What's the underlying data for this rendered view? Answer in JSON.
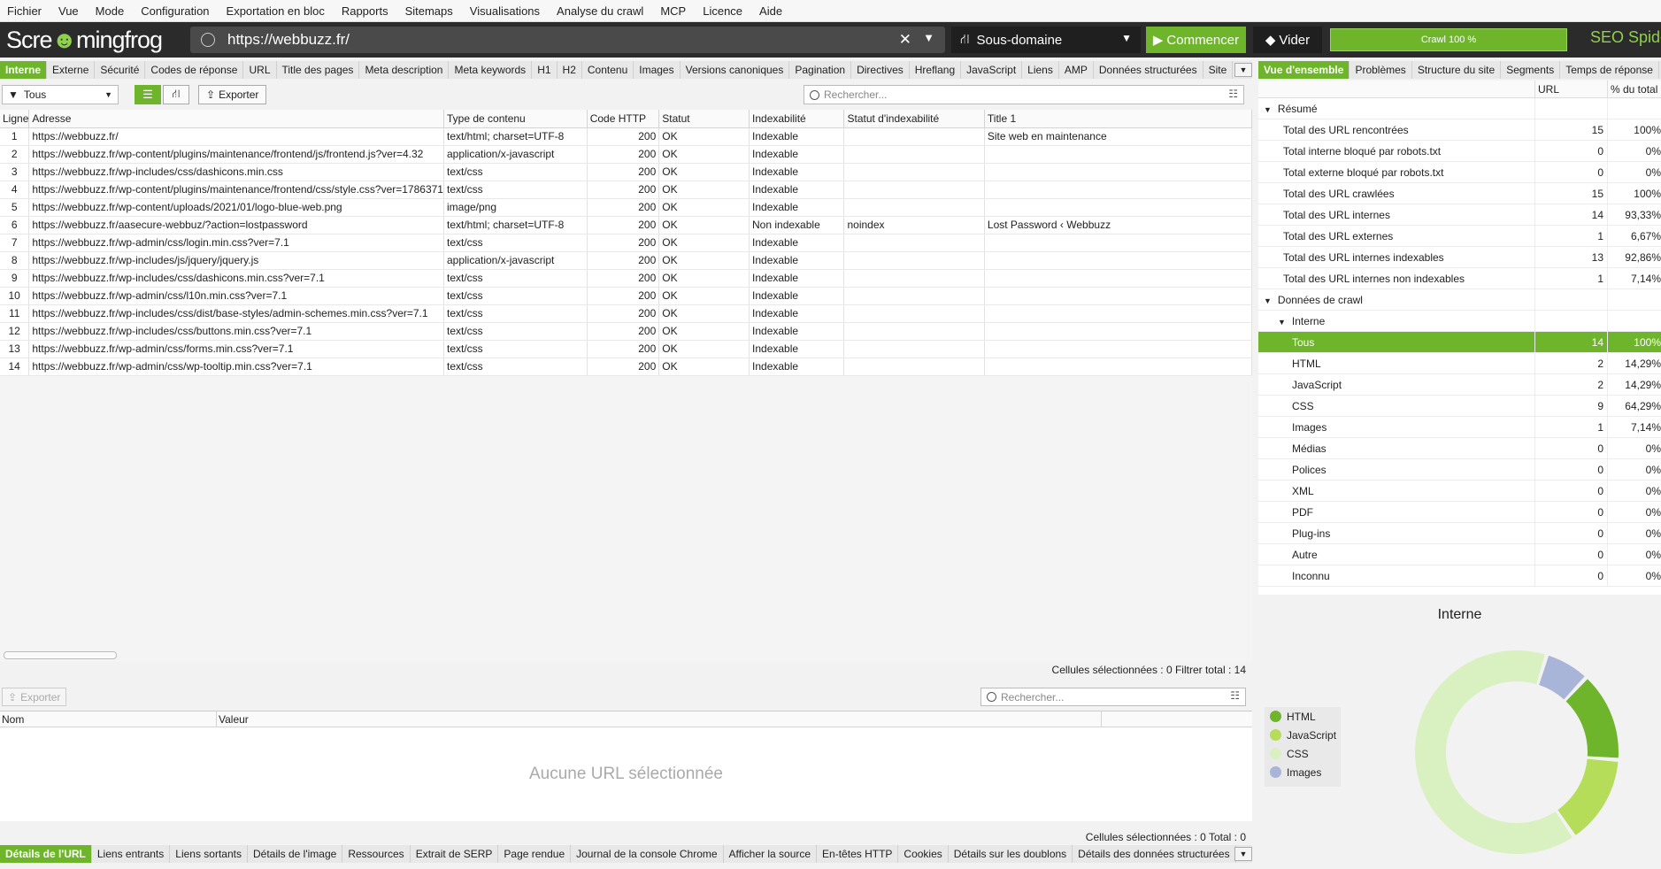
{
  "menu": [
    "Fichier",
    "Vue",
    "Mode",
    "Configuration",
    "Exportation en bloc",
    "Rapports",
    "Sitemaps",
    "Visualisations",
    "Analyse du crawl",
    "MCP",
    "Licence",
    "Aide"
  ],
  "logo": {
    "part1": "Scre",
    "part2": "mingfrog"
  },
  "url_value": "https://webbuzz.fr/",
  "mode_label": "Sous-domaine",
  "start_label": "Commencer",
  "clear_label": "Vider",
  "progress_label": "Crawl 100 %",
  "progress_value": 1.0,
  "product_label": "SEO Spider",
  "tabs": [
    "Interne",
    "Externe",
    "Sécurité",
    "Codes de réponse",
    "URL",
    "Title des pages",
    "Meta description",
    "Meta keywords",
    "H1",
    "H2",
    "Contenu",
    "Images",
    "Versions canoniques",
    "Pagination",
    "Directives",
    "Hreflang",
    "JavaScript",
    "Liens",
    "AMP",
    "Données structurées",
    "Site"
  ],
  "right_tabs": [
    "Vue d'ensemble",
    "Problèmes",
    "Structure du site",
    "Segments",
    "Temps de réponse"
  ],
  "filter_label": "Tous",
  "export_label": "Exporter",
  "search_placeholder": "Rechercher...",
  "table": {
    "columns": [
      "Ligne",
      "Adresse",
      "Type de contenu",
      "Code HTTP",
      "Statut",
      "Indexabilité",
      "Statut d'indexabilité",
      "Title 1"
    ],
    "rows": [
      [
        "1",
        "https://webbuzz.fr/",
        "text/html; charset=UTF-8",
        "200",
        "OK",
        "Indexable",
        "",
        "Site web en maintenance"
      ],
      [
        "2",
        "https://webbuzz.fr/wp-content/plugins/maintenance/frontend/js/frontend.js?ver=4.32",
        "application/x-javascript",
        "200",
        "OK",
        "Indexable",
        "",
        ""
      ],
      [
        "3",
        "https://webbuzz.fr/wp-includes/css/dashicons.min.css",
        "text/css",
        "200",
        "OK",
        "Indexable",
        "",
        ""
      ],
      [
        "4",
        "https://webbuzz.fr/wp-content/plugins/maintenance/frontend/css/style.css?ver=1786371",
        "text/css",
        "200",
        "OK",
        "Indexable",
        "",
        ""
      ],
      [
        "5",
        "https://webbuzz.fr/wp-content/uploads/2021/01/logo-blue-web.png",
        "image/png",
        "200",
        "OK",
        "Indexable",
        "",
        ""
      ],
      [
        "6",
        "https://webbuzz.fr/aasecure-webbuz/?action=lostpassword",
        "text/html; charset=UTF-8",
        "200",
        "OK",
        "Non indexable",
        "noindex",
        "Lost Password ‹ Webbuzz"
      ],
      [
        "7",
        "https://webbuzz.fr/wp-admin/css/login.min.css?ver=7.1",
        "text/css",
        "200",
        "OK",
        "Indexable",
        "",
        ""
      ],
      [
        "8",
        "https://webbuzz.fr/wp-includes/js/jquery/jquery.js",
        "application/x-javascript",
        "200",
        "OK",
        "Indexable",
        "",
        ""
      ],
      [
        "9",
        "https://webbuzz.fr/wp-includes/css/dashicons.min.css?ver=7.1",
        "text/css",
        "200",
        "OK",
        "Indexable",
        "",
        ""
      ],
      [
        "10",
        "https://webbuzz.fr/wp-admin/css/l10n.min.css?ver=7.1",
        "text/css",
        "200",
        "OK",
        "Indexable",
        "",
        ""
      ],
      [
        "11",
        "https://webbuzz.fr/wp-includes/css/dist/base-styles/admin-schemes.min.css?ver=7.1",
        "text/css",
        "200",
        "OK",
        "Indexable",
        "",
        ""
      ],
      [
        "12",
        "https://webbuzz.fr/wp-includes/css/buttons.min.css?ver=7.1",
        "text/css",
        "200",
        "OK",
        "Indexable",
        "",
        ""
      ],
      [
        "13",
        "https://webbuzz.fr/wp-admin/css/forms.min.css?ver=7.1",
        "text/css",
        "200",
        "OK",
        "Indexable",
        "",
        ""
      ],
      [
        "14",
        "https://webbuzz.fr/wp-admin/css/wp-tooltip.min.css?ver=7.1",
        "text/css",
        "200",
        "OK",
        "Indexable",
        "",
        ""
      ]
    ]
  },
  "status_top": "Cellules sélectionnées : 0  Filtrer total : 14",
  "lower": {
    "export_label": "Exporter",
    "search_placeholder": "Rechercher...",
    "col_name": "Nom",
    "col_value": "Valeur",
    "empty_message": "Aucune URL sélectionnée"
  },
  "status_bottom": "Cellules sélectionnées : 0  Total : 0",
  "bottom_tabs": [
    "Détails de l'URL",
    "Liens entrants",
    "Liens sortants",
    "Détails de l'image",
    "Ressources",
    "Extrait de SERP",
    "Page rendue",
    "Journal de la console Chrome",
    "Afficher la source",
    "En-têtes HTTP",
    "Cookies",
    "Détails sur les doublons",
    "Détails des données structurées"
  ],
  "overview": {
    "col_url": "URL",
    "col_pct": "% du total",
    "rows": [
      {
        "label": "Résumé",
        "url": "",
        "pct": "",
        "level": 0,
        "section": true
      },
      {
        "label": "Total des URL rencontrées",
        "url": "15",
        "pct": "100%",
        "level": 1
      },
      {
        "label": "Total interne bloqué par robots.txt",
        "url": "0",
        "pct": "0%",
        "level": 1
      },
      {
        "label": "Total externe bloqué par robots.txt",
        "url": "0",
        "pct": "0%",
        "level": 1
      },
      {
        "label": "Total des URL crawlées",
        "url": "15",
        "pct": "100%",
        "level": 1
      },
      {
        "label": "Total des URL internes",
        "url": "14",
        "pct": "93,33%",
        "level": 1
      },
      {
        "label": "Total des URL externes",
        "url": "1",
        "pct": "6,67%",
        "level": 1
      },
      {
        "label": "Total des URL internes indexables",
        "url": "13",
        "pct": "92,86%",
        "level": 1
      },
      {
        "label": "Total des URL internes non indexables",
        "url": "1",
        "pct": "7,14%",
        "level": 1
      },
      {
        "label": "Données de crawl",
        "url": "",
        "pct": "",
        "level": 0,
        "section": true
      },
      {
        "label": "Interne",
        "url": "",
        "pct": "",
        "level": 1,
        "section": true
      },
      {
        "label": "Tous",
        "url": "14",
        "pct": "100%",
        "level": 2,
        "selected": true
      },
      {
        "label": "HTML",
        "url": "2",
        "pct": "14,29%",
        "level": 2
      },
      {
        "label": "JavaScript",
        "url": "2",
        "pct": "14,29%",
        "level": 2
      },
      {
        "label": "CSS",
        "url": "9",
        "pct": "64,29%",
        "level": 2
      },
      {
        "label": "Images",
        "url": "1",
        "pct": "7,14%",
        "level": 2
      },
      {
        "label": "Médias",
        "url": "0",
        "pct": "0%",
        "level": 2
      },
      {
        "label": "Polices",
        "url": "0",
        "pct": "0%",
        "level": 2
      },
      {
        "label": "XML",
        "url": "0",
        "pct": "0%",
        "level": 2
      },
      {
        "label": "PDF",
        "url": "0",
        "pct": "0%",
        "level": 2
      },
      {
        "label": "Plug-ins",
        "url": "0",
        "pct": "0%",
        "level": 2
      },
      {
        "label": "Autre",
        "url": "0",
        "pct": "0%",
        "level": 2
      },
      {
        "label": "Inconnu",
        "url": "0",
        "pct": "0%",
        "level": 2
      }
    ]
  },
  "chart_data": {
    "type": "pie",
    "title": "Interne",
    "categories": [
      "HTML",
      "JavaScript",
      "CSS",
      "Images"
    ],
    "values": [
      2,
      2,
      9,
      1
    ],
    "colors": [
      "#6fb52c",
      "#b5dd5a",
      "#d9f0c0",
      "#a8b4d8"
    ],
    "legend": "left"
  }
}
